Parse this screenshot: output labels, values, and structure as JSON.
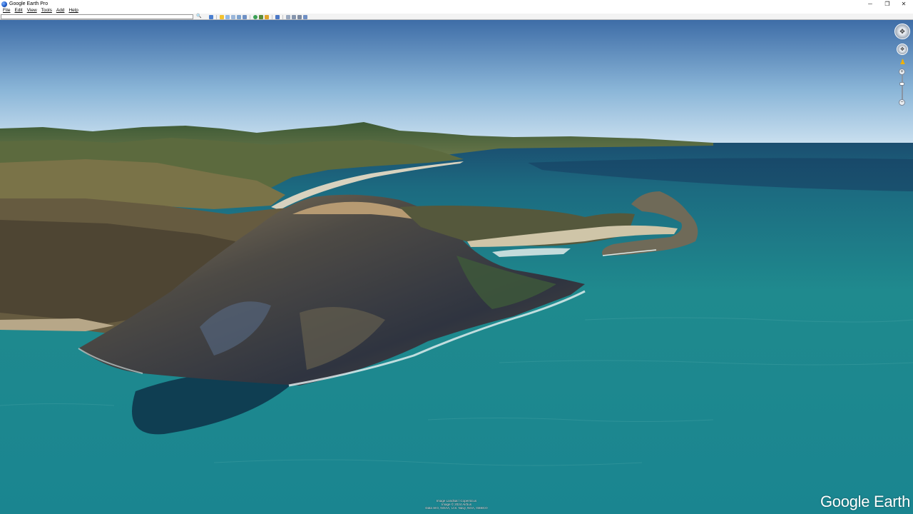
{
  "window": {
    "title": "Google Earth Pro",
    "minimize_glyph": "─",
    "restore_glyph": "❐",
    "close_glyph": "✕"
  },
  "menu": {
    "items": [
      "File",
      "Edit",
      "View",
      "Tools",
      "Add",
      "Help"
    ]
  },
  "toolbar": {
    "search_value": "",
    "search_placeholder": "",
    "search_glyph": "🔍",
    "icons": [
      "sidebar-icon",
      "placemark-icon",
      "polygon-icon",
      "path-icon",
      "image-overlay-icon",
      "record-tour-icon",
      "historical-imagery-icon",
      "sun-icon",
      "planets-icon",
      "ruler-icon",
      "email-icon",
      "print-icon",
      "save-image-icon",
      "view-in-maps-icon"
    ]
  },
  "navigation": {
    "look_glyph": "✥",
    "move_glyph": "✥",
    "pegman_glyph": "♟",
    "zoom_in_glyph": "+",
    "zoom_out_glyph": "−",
    "zoom_level": 0.33
  },
  "attribution": {
    "line1": "Image Landsat / Copernicus",
    "line2": "Image © 2024 Airbus",
    "line3": "Data SIO, NOAA, U.S. Navy, NGA, GEBCO"
  },
  "logo": {
    "text": "Google Earth"
  },
  "colors": {
    "sky_top": "#3f6ea8",
    "sky_horizon": "#c7dff0",
    "ocean": "#1f8a8e",
    "ocean_far": "#1c5375",
    "land": "#4f5a3a"
  }
}
